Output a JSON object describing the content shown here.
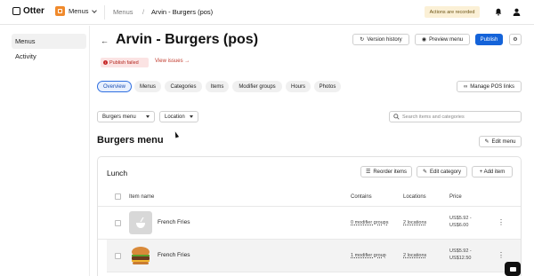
{
  "app": {
    "logo_text": "Otter",
    "menus_switch_label": "Menus"
  },
  "breadcrumb": {
    "parent": "Menus",
    "separator": "/",
    "current": "Arvin - Burgers (pos)"
  },
  "topbar": {
    "recorded_badge": "Actions are recorded",
    "icons": [
      "bell-icon",
      "user-icon"
    ]
  },
  "sidebar": {
    "items": [
      {
        "label": "Menus",
        "active": true
      },
      {
        "label": "Activity",
        "active": false
      }
    ]
  },
  "header": {
    "title": "Arvin - Burgers (pos)",
    "publish_status": "Publish failed",
    "view_issues": "View issues",
    "buttons": {
      "version_history": "Version history",
      "preview_menu": "Preview menu",
      "publish": "Publish"
    }
  },
  "tabs": [
    {
      "label": "Overview",
      "active": true
    },
    {
      "label": "Menus",
      "active": false
    },
    {
      "label": "Categories",
      "active": false
    },
    {
      "label": "Items",
      "active": false
    },
    {
      "label": "Modifier groups",
      "active": false
    },
    {
      "label": "Hours",
      "active": false
    },
    {
      "label": "Photos",
      "active": false
    }
  ],
  "manage_pos_links": "Manage POS links",
  "filters": {
    "menu_select": "Burgers menu",
    "location_select": "Location",
    "search_placeholder": "Search items and categories"
  },
  "section": {
    "title": "Burgers menu",
    "edit_menu": "Edit menu"
  },
  "category": {
    "title": "Lunch",
    "buttons": {
      "reorder_items": "Reorder items",
      "edit_category": "Edit category",
      "add_item": "+ Add item"
    },
    "columns": [
      "Item name",
      "Contains",
      "Locations",
      "Price"
    ],
    "rows": [
      {
        "name": "French Fries",
        "contains": "0 modifier groups",
        "locations": "2 locations",
        "price_line1": "US$5.92 -",
        "price_line2": "US$6.00"
      },
      {
        "name": "French Fries",
        "contains": "1 modifier group",
        "locations": "2 locations",
        "price_line1": "US$5.92 -",
        "price_line2": "US$12.50"
      }
    ]
  },
  "colors": {
    "primary": "#1463d9",
    "error": "#c62828",
    "badge_bg": "#fbf0d6",
    "brand_orange": "#f08a2c"
  }
}
